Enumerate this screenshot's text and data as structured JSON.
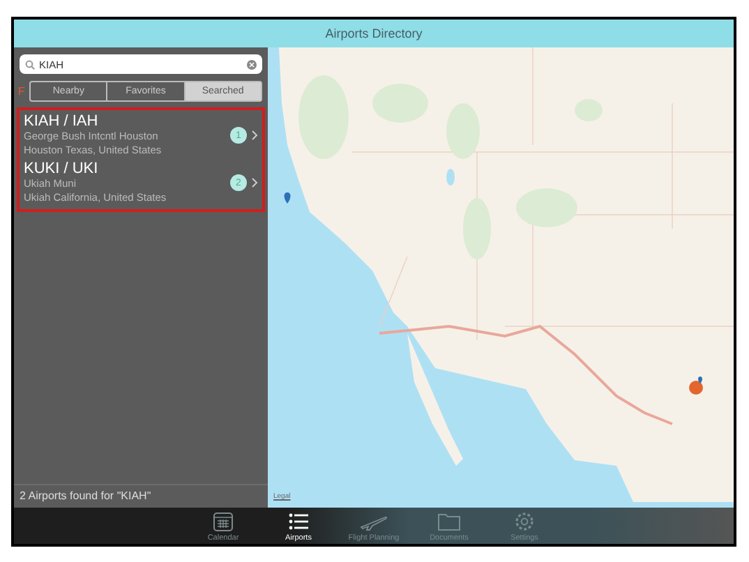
{
  "window": {
    "title": "Airports Directory"
  },
  "search": {
    "value": "KIAH"
  },
  "index_letter": "F",
  "segments": [
    {
      "label": "Nearby",
      "selected": false
    },
    {
      "label": "Favorites",
      "selected": false
    },
    {
      "label": "Searched",
      "selected": true
    }
  ],
  "results": [
    {
      "code": "KIAH / IAH",
      "name": "George Bush Intcntl Houston",
      "location": "Houston Texas, United States",
      "badge": "1"
    },
    {
      "code": "KUKI / UKI",
      "name": "Ukiah Muni",
      "location": "Ukiah California, United States",
      "badge": "2"
    }
  ],
  "status": "2 Airports found for \"KIAH\"",
  "map": {
    "legal": "Legal"
  },
  "tab_bar": [
    {
      "label": "Calendar",
      "selected": false
    },
    {
      "label": "Airports",
      "selected": true
    },
    {
      "label": "Flight Planning",
      "selected": false
    },
    {
      "label": "Documents",
      "selected": false
    },
    {
      "label": "Settings",
      "selected": false
    }
  ]
}
